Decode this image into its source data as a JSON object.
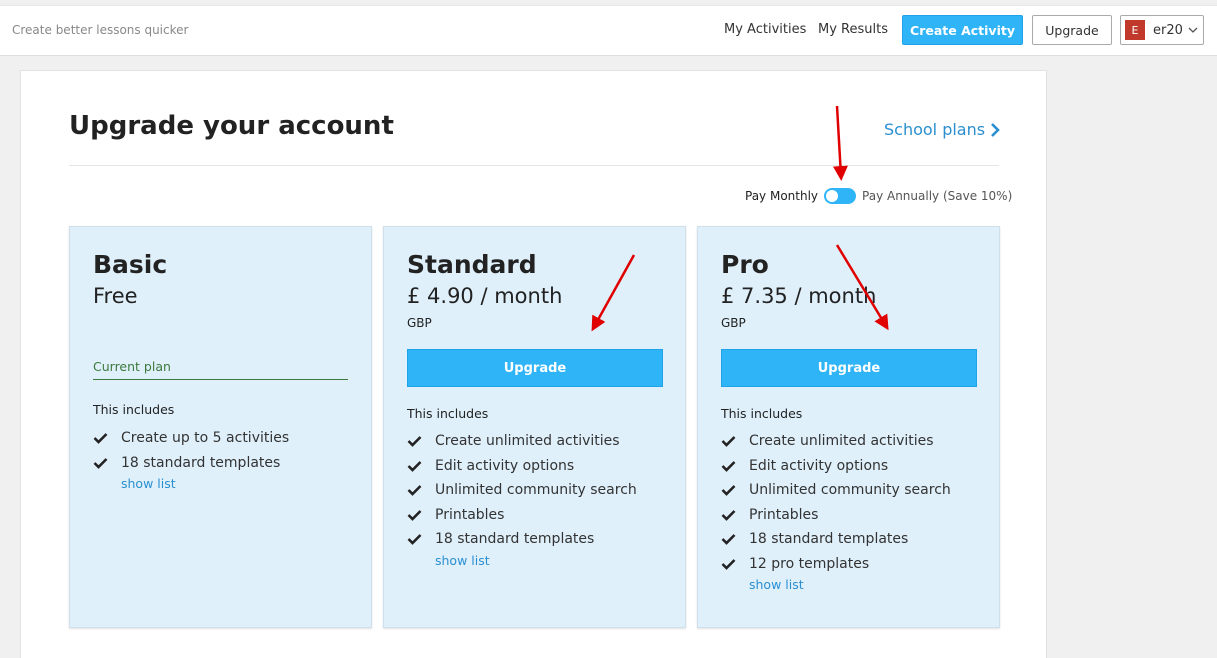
{
  "header": {
    "tagline": "Create better lessons quicker",
    "nav": [
      "My Activities",
      "My Results"
    ],
    "create_label": "Create Activity",
    "upgrade_label": "Upgrade",
    "user": {
      "initial": "E",
      "name": "er20"
    }
  },
  "page": {
    "title": "Upgrade your account",
    "school_link": "School plans",
    "toggle": {
      "left_label": "Pay Monthly",
      "right_label": "Pay Annually (Save 10%)",
      "annual": false
    }
  },
  "plans": [
    {
      "name": "Basic",
      "price": "Free",
      "currency": "",
      "status": "Current plan",
      "includes_label": "This includes",
      "features": [
        "Create up to 5 activities",
        "18 standard templates"
      ],
      "show_list": "show list"
    },
    {
      "name": "Standard",
      "price": "£ 4.90 / month",
      "currency": "GBP",
      "button": "Upgrade",
      "includes_label": "This includes",
      "features": [
        "Create unlimited activities",
        "Edit activity options",
        "Unlimited community search",
        "Printables",
        "18 standard templates"
      ],
      "show_list": "show list"
    },
    {
      "name": "Pro",
      "price": "£ 7.35 / month",
      "currency": "GBP",
      "button": "Upgrade",
      "includes_label": "This includes",
      "features": [
        "Create unlimited activities",
        "Edit activity options",
        "Unlimited community search",
        "Printables",
        "18 standard templates",
        "12 pro templates"
      ],
      "show_list": "show list"
    }
  ],
  "colors": {
    "accent": "#2fb5f7",
    "link": "#2a8fd0",
    "card_bg": "#dff0fb",
    "current": "#3c7a3c",
    "annotation": "#e00000"
  }
}
